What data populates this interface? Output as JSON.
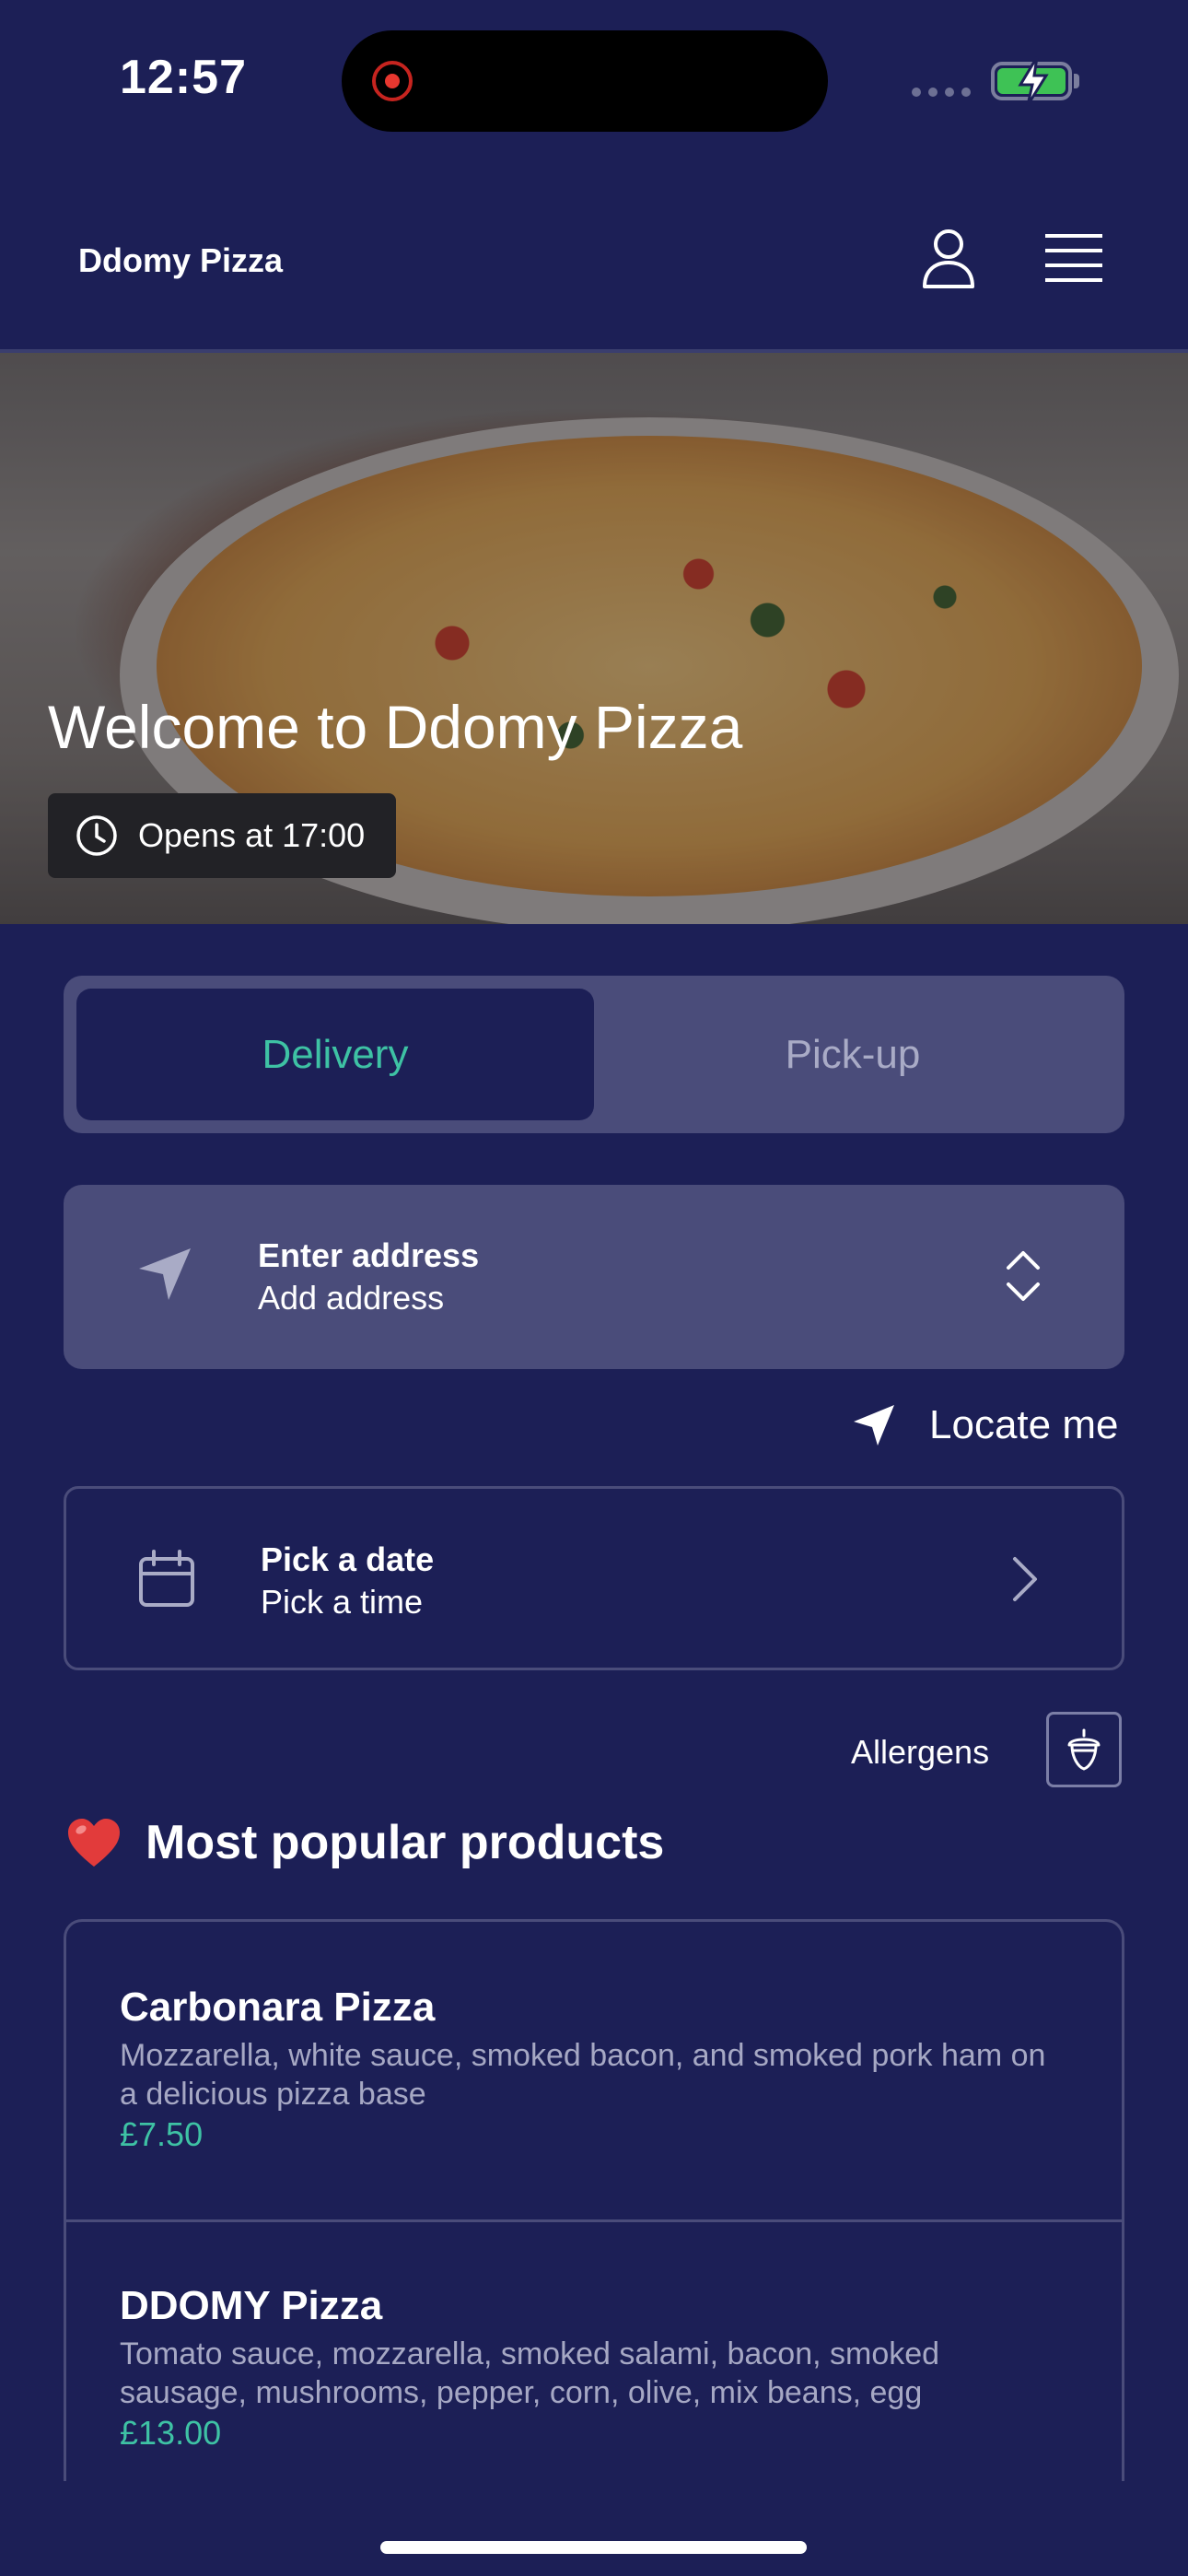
{
  "status_bar": {
    "time": "12:57"
  },
  "header": {
    "brand": "Ddomy Pizza",
    "icons": [
      "user-icon",
      "menu-icon"
    ]
  },
  "hero": {
    "title": "Welcome to Ddomy Pizza",
    "hours": "Opens at 17:00"
  },
  "mode_toggle": {
    "delivery": "Delivery",
    "pickup": "Pick-up",
    "selected": "Delivery"
  },
  "address": {
    "title": "Enter address",
    "subtitle": "Add address"
  },
  "locate": {
    "label": "Locate me"
  },
  "schedule": {
    "title": "Pick a date",
    "subtitle": "Pick a time"
  },
  "allergens": {
    "label": "Allergens"
  },
  "popular": {
    "title": "Most popular products",
    "products": [
      {
        "name": "Carbonara Pizza",
        "description": "Mozzarella, white sauce, smoked bacon, and smoked pork ham on a delicious pizza base",
        "price": "£7.50"
      },
      {
        "name": "DDOMY Pizza",
        "description": "Tomato sauce, mozzarella, smoked salami, bacon, smoked sausage, mushrooms, pepper, corn, olive, mix beans, egg",
        "price": "£13.00"
      }
    ]
  },
  "colors": {
    "background": "#1c1f56",
    "card": "#4a4c7a",
    "accent": "#3ec2a4"
  }
}
